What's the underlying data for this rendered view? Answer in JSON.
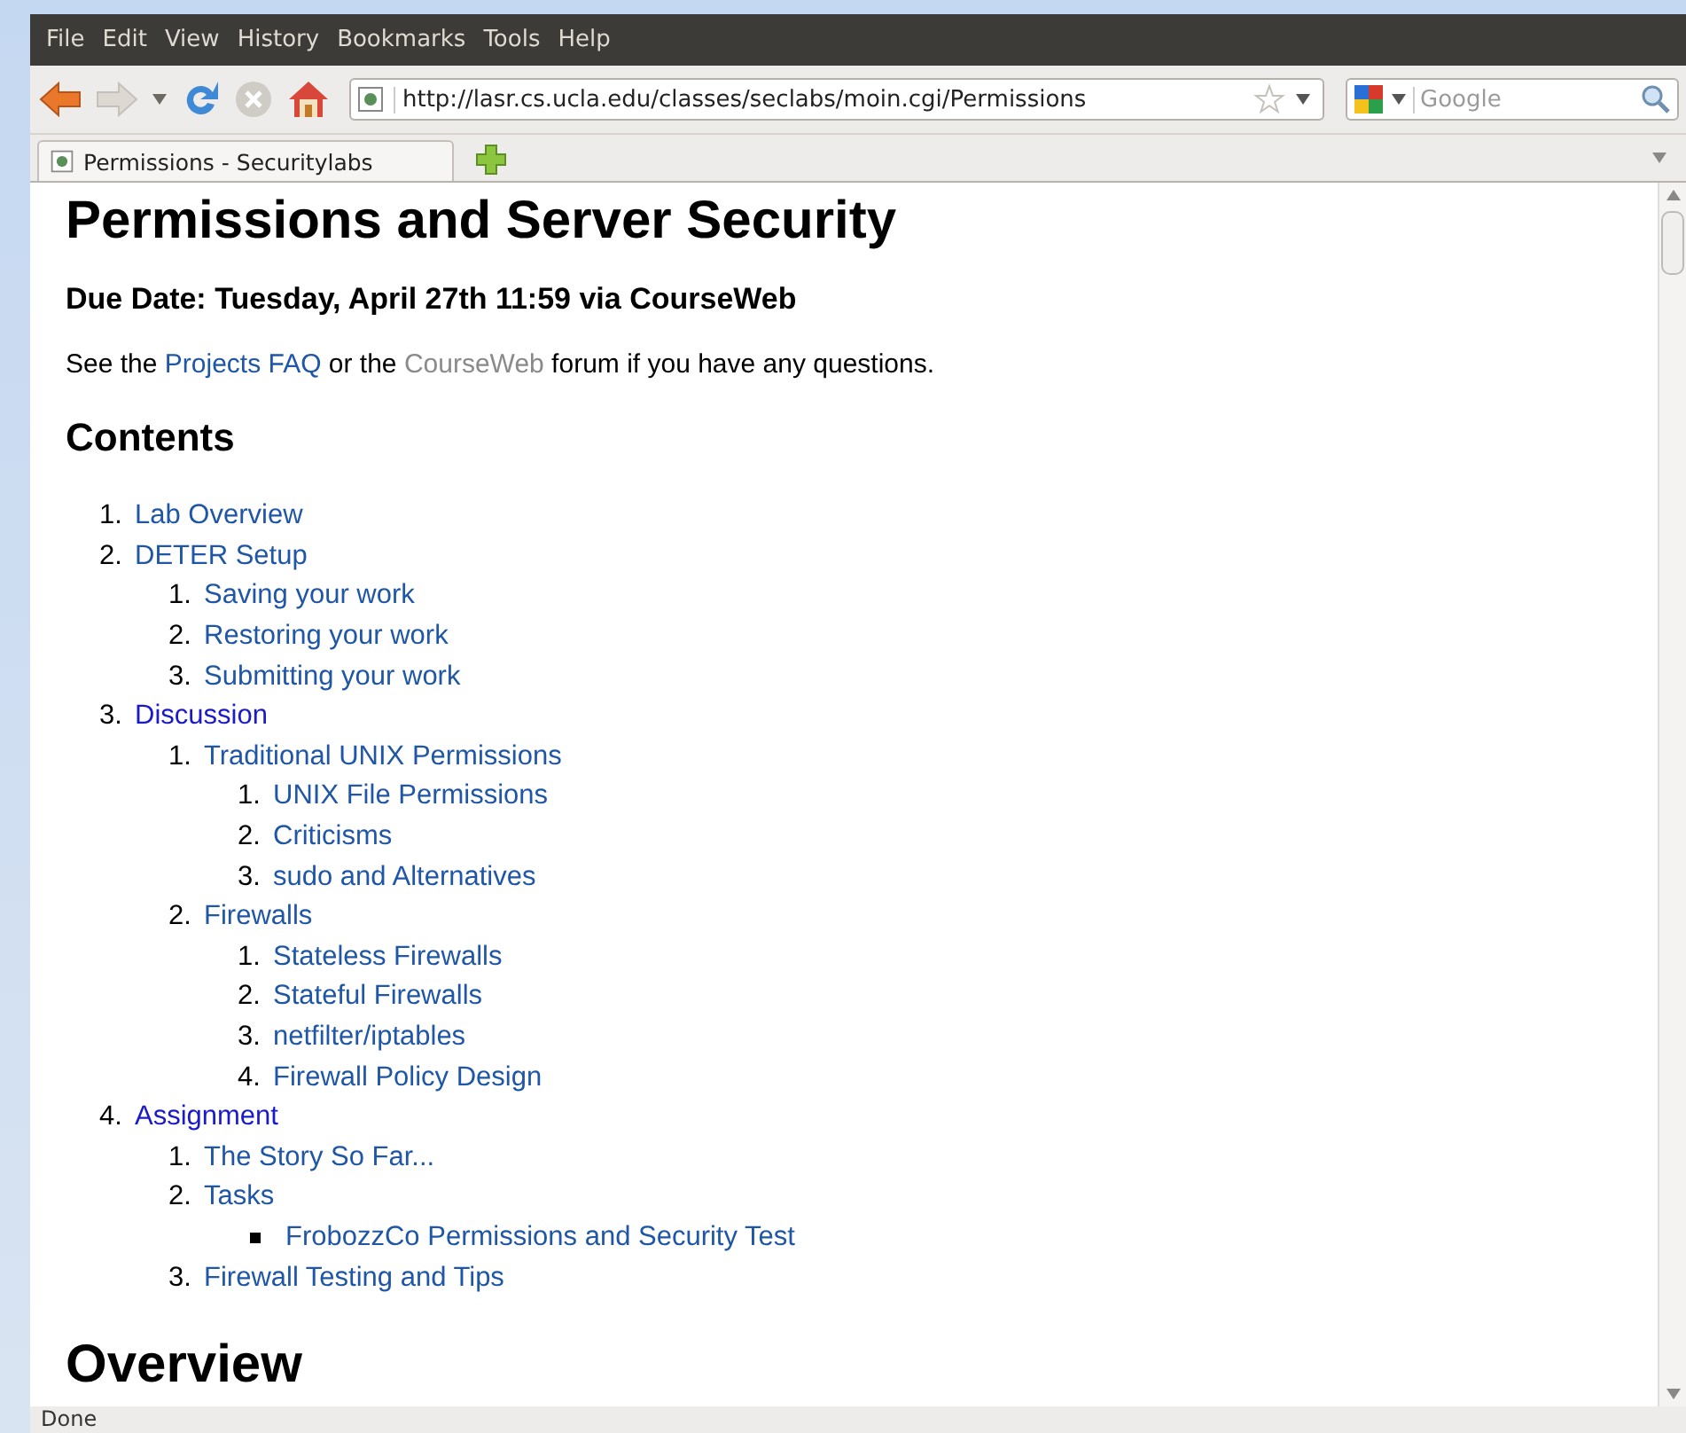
{
  "menu": [
    {
      "label": "File"
    },
    {
      "label": "Edit"
    },
    {
      "label": "View"
    },
    {
      "label": "History"
    },
    {
      "label": "Bookmarks"
    },
    {
      "label": "Tools"
    },
    {
      "label": "Help"
    }
  ],
  "toolbar": {
    "url": "http://lasr.cs.ucla.edu/classes/seclabs/moin.cgi/Permissions",
    "search_placeholder": "Google"
  },
  "tabs": [
    {
      "title": "Permissions - Securitylabs",
      "selected": true
    }
  ],
  "page": {
    "title": "Permissions and Server Security",
    "due": "Due Date: Tuesday, April 27th 11:59 via CourseWeb",
    "intro": [
      {
        "kind": "text",
        "text": "See the "
      },
      {
        "kind": "link",
        "text": "Projects FAQ"
      },
      {
        "kind": "text",
        "text": " or the "
      },
      {
        "kind": "dim-link",
        "text": "CourseWeb"
      },
      {
        "kind": "text",
        "text": " forum if you have any questions."
      }
    ],
    "contents_heading": "Contents",
    "contents": [
      {
        "marker": "1.",
        "text": "Lab Overview",
        "visited": false
      },
      {
        "marker": "2.",
        "text": "DETER Setup",
        "visited": false,
        "children": [
          {
            "marker": "1.",
            "text": "Saving your work",
            "visited": false
          },
          {
            "marker": "2.",
            "text": "Restoring your work",
            "visited": false
          },
          {
            "marker": "3.",
            "text": "Submitting your work",
            "visited": false
          }
        ]
      },
      {
        "marker": "3.",
        "text": "Discussion",
        "visited": true,
        "children": [
          {
            "marker": "1.",
            "text": "Traditional UNIX Permissions",
            "visited": false,
            "children": [
              {
                "marker": "1.",
                "text": "UNIX File Permissions",
                "visited": false
              },
              {
                "marker": "2.",
                "text": "Criticisms",
                "visited": false
              },
              {
                "marker": "3.",
                "text": "sudo and Alternatives",
                "visited": false
              }
            ]
          },
          {
            "marker": "2.",
            "text": "Firewalls",
            "visited": false,
            "children": [
              {
                "marker": "1.",
                "text": "Stateless Firewalls",
                "visited": false
              },
              {
                "marker": "2.",
                "text": "Stateful Firewalls",
                "visited": false
              },
              {
                "marker": "3.",
                "text": "netfilter/iptables",
                "visited": false
              },
              {
                "marker": "4.",
                "text": "Firewall Policy Design",
                "visited": false
              }
            ]
          }
        ]
      },
      {
        "marker": "4.",
        "text": "Assignment",
        "visited": true,
        "children": [
          {
            "marker": "1.",
            "text": "The Story So Far...",
            "visited": false
          },
          {
            "marker": "2.",
            "text": "Tasks",
            "visited": false,
            "children": [
              {
                "kind": "bullet",
                "text": "FrobozzCo Permissions and Security Test",
                "visited": false
              }
            ]
          },
          {
            "marker": "3.",
            "text": "Firewall Testing and Tips",
            "visited": false
          }
        ]
      }
    ],
    "next_heading": "Overview"
  },
  "status": "Done"
}
